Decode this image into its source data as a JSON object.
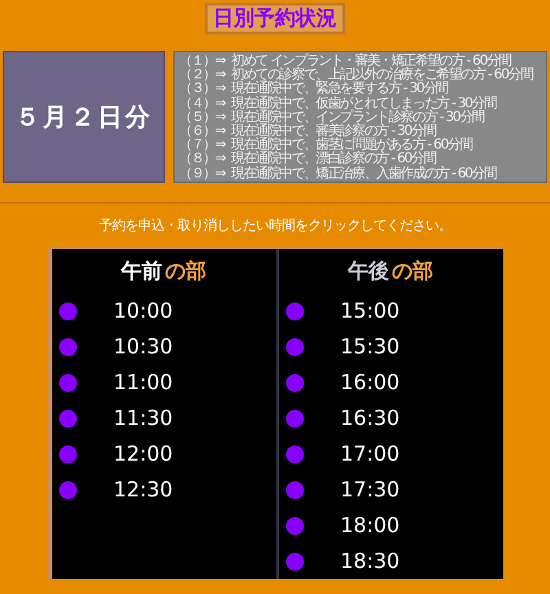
{
  "title": "日別予約状況",
  "date_label": "５月２日分",
  "legend": [
    {
      "marker": "（１）⇒",
      "text": "初めて インプラント・審美・矯正希望の方 - 60分間"
    },
    {
      "marker": "（２）⇒",
      "text": "初めての診察で、上記以外の治療をご希望の方 - 60分間"
    },
    {
      "marker": "（３）⇒",
      "text": "現在通院中で、緊急を要する方 - 30分間"
    },
    {
      "marker": "（４）⇒",
      "text": "現在通院中で、仮歯がとれてしまった方 - 30分間"
    },
    {
      "marker": "（５）⇒",
      "text": "現在通院中で、インプラント診察の方 - 30分間"
    },
    {
      "marker": "（６）⇒",
      "text": "現在通院中で、審美診察の方 - 30分間"
    },
    {
      "marker": "（７）⇒",
      "text": "現在通院中で、歯茎に問題がある方 - 60分間"
    },
    {
      "marker": "（８）⇒",
      "text": "現在通院中で、漂白診察の方 - 60分間"
    },
    {
      "marker": "（９）⇒",
      "text": "現在通院中で、矯正治療、入歯作成の方 - 60分間"
    }
  ],
  "instruction": "予約を申込・取り消ししたい時間をクリックしてください。",
  "columns": [
    {
      "heading": "午前",
      "heading_suffix": "の部",
      "slots": [
        "10:00",
        "10:30",
        "11:00",
        "11:30",
        "12:00",
        "12:30"
      ]
    },
    {
      "heading": "午後",
      "heading_suffix": "の部",
      "slots": [
        "15:00",
        "15:30",
        "16:00",
        "16:30",
        "17:00",
        "17:30",
        "18:00",
        "18:30"
      ]
    }
  ]
}
